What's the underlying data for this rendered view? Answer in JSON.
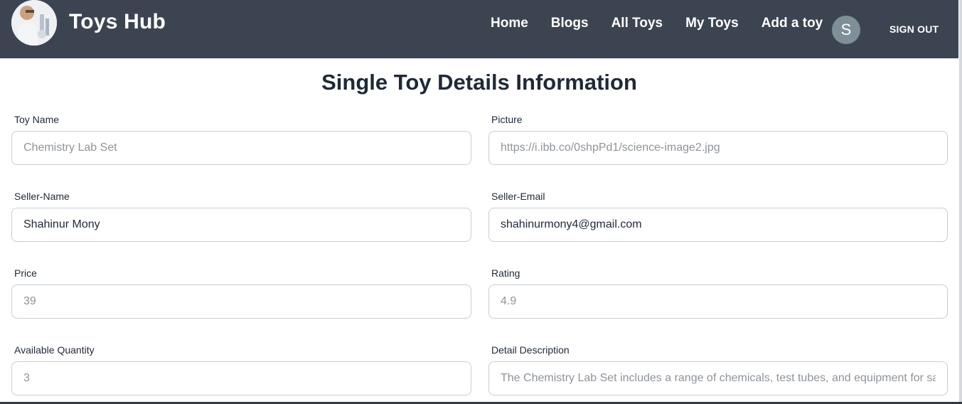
{
  "navbar": {
    "brand": "Toys Hub",
    "links": [
      "Home",
      "Blogs",
      "All Toys",
      "My Toys",
      "Add a toy"
    ],
    "avatar_initial": "S",
    "signout": "SIGN OUT"
  },
  "page": {
    "title": "Single Toy Details Information"
  },
  "form": {
    "toy_name": {
      "label": "Toy Name",
      "value": "",
      "placeholder": "Chemistry Lab Set"
    },
    "picture": {
      "label": "Picture",
      "value": "",
      "placeholder": "https://i.ibb.co/0shpPd1/science-image2.jpg"
    },
    "seller_name": {
      "label": "Seller-Name",
      "value": "Shahinur Mony",
      "placeholder": ""
    },
    "seller_email": {
      "label": "Seller-Email",
      "value": "shahinurmony4@gmail.com",
      "placeholder": ""
    },
    "price": {
      "label": "Price",
      "value": "",
      "placeholder": "39"
    },
    "rating": {
      "label": "Rating",
      "value": "",
      "placeholder": "4.9"
    },
    "quantity": {
      "label": "Available Quantity",
      "value": "",
      "placeholder": "3"
    },
    "description": {
      "label": "Detail Description",
      "value": "",
      "placeholder": "The Chemistry Lab Set includes a range of chemicals, test tubes, and equipment for safe"
    }
  }
}
